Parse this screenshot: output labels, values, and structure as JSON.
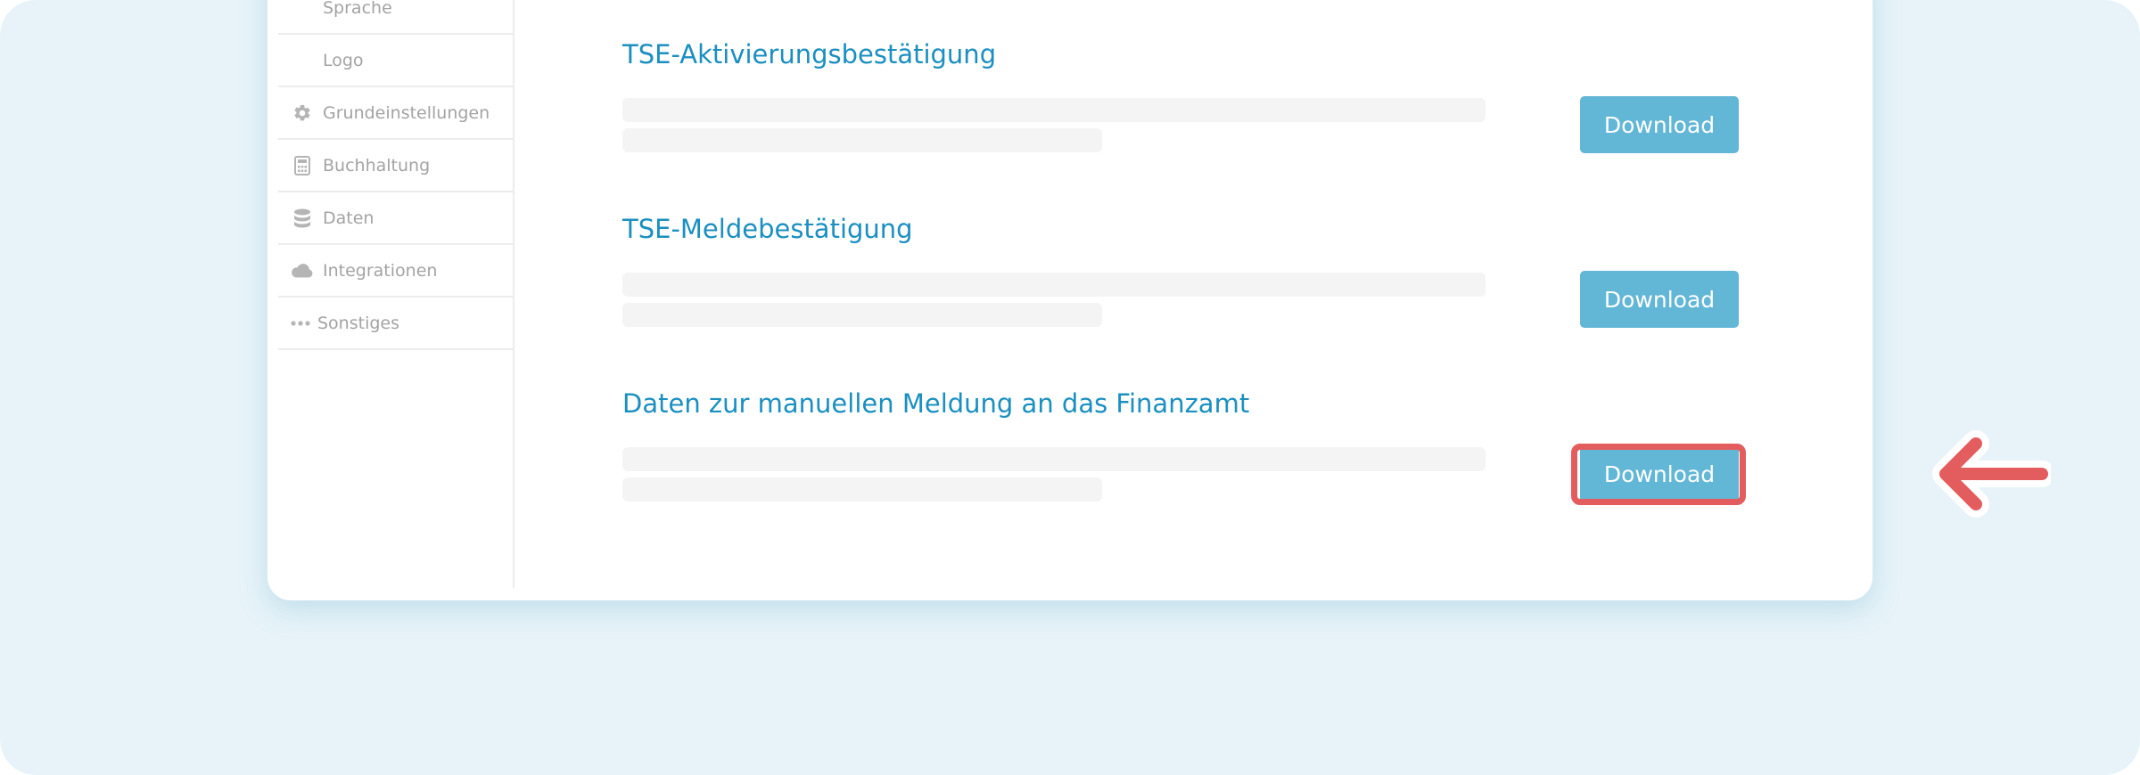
{
  "sidebar": {
    "items": [
      {
        "label": "Sprache",
        "icon": "none",
        "sub": true
      },
      {
        "label": "Logo",
        "icon": "none",
        "sub": true
      },
      {
        "label": "Grundeinstellungen",
        "icon": "gear-icon"
      },
      {
        "label": "Buchhaltung",
        "icon": "calculator-icon"
      },
      {
        "label": "Daten",
        "icon": "database-icon"
      },
      {
        "label": "Integrationen",
        "icon": "cloud-icon"
      },
      {
        "label": "Sonstiges",
        "icon": "more-dots-icon"
      }
    ]
  },
  "sections": [
    {
      "title": "TSE-Aktivierungsbestätigung",
      "button_label": "Download"
    },
    {
      "title": "TSE-Meldebestätigung",
      "button_label": "Download"
    },
    {
      "title": "Daten zur manuellen Meldung an das Finanzamt",
      "button_label": "Download"
    }
  ],
  "colors": {
    "accent_text": "#1a8fc0",
    "button": "#62b6d6",
    "highlight": "#e45d5e",
    "background": "#e7f3f9"
  }
}
